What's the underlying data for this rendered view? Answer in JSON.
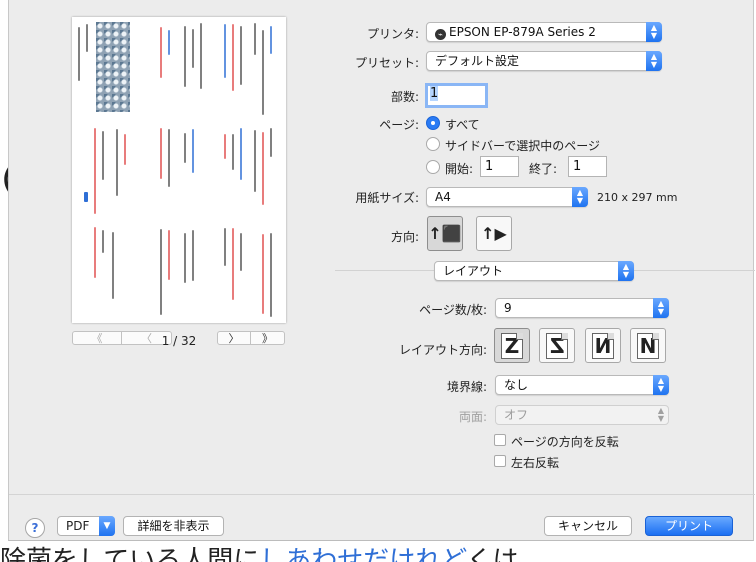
{
  "background": {
    "left_mark": "〇",
    "bottom_text": "除菌をしている人間に",
    "bottom_link": "しあわせだけれど",
    "bottom_tail": "くは"
  },
  "preview": {
    "nav": {
      "first": "《",
      "prev": "〈",
      "next": "〉",
      "last": "》"
    },
    "page_indicator": "1 / 32"
  },
  "form": {
    "printer": {
      "label": "プリンタ:",
      "value": "EPSON EP-879A Series 2",
      "icon": "printer-icon"
    },
    "preset": {
      "label": "プリセット:",
      "value": "デフォルト設定"
    },
    "copies": {
      "label": "部数:",
      "value": "1"
    },
    "pages": {
      "label": "ページ:",
      "all": "すべて",
      "selection": "サイドバーで選択中のページ",
      "from_label": "開始:",
      "from_value": "1",
      "to_label": "終了:",
      "to_value": "1",
      "selected": "all"
    },
    "paper": {
      "label": "用紙サイズ:",
      "value": "A4",
      "dims": "210 x 297 mm"
    },
    "orientation": {
      "label": "方向:",
      "options": [
        "portrait",
        "landscape"
      ],
      "selected": "portrait"
    },
    "section": {
      "value": "レイアウト"
    },
    "pages_per_sheet": {
      "label": "ページ数/枚:",
      "value": "9"
    },
    "layout_direction": {
      "label": "レイアウト方向:",
      "glyphs": [
        "Z",
        "Z",
        "И",
        "N"
      ],
      "selected": 0
    },
    "border": {
      "label": "境界線:",
      "value": "なし"
    },
    "two_sided": {
      "label": "両面:",
      "value": "オフ",
      "enabled": false
    },
    "reverse_orientation": {
      "label": "ページの方向を反転",
      "checked": false
    },
    "flip_horizontal": {
      "label": "左右反転",
      "checked": false
    }
  },
  "footer": {
    "help": "?",
    "pdf": "PDF",
    "hide_details": "詳細を非表示",
    "cancel": "キャンセル",
    "print": "プリント"
  },
  "colors": {
    "accent": "#1f73f0",
    "sheet_bg": "#ececec",
    "link": "#2f6fd6"
  }
}
